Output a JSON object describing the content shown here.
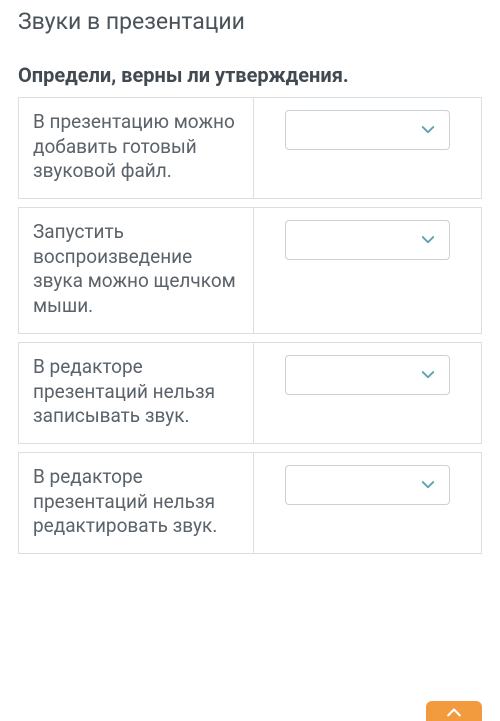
{
  "title": "Звуки в презентации",
  "instruction": "Определи, верны ли утверждения.",
  "rows": [
    {
      "text": "В презентацию можно добавить готовый звуковой файл.",
      "selected": ""
    },
    {
      "text": "Запустить воспроизведение звука можно щелчком мыши.",
      "selected": ""
    },
    {
      "text": "В редакторе презентаций нельзя записывать звук.",
      "selected": ""
    },
    {
      "text": "В редакторе презентаций нельзя редактировать звук.",
      "selected": ""
    }
  ],
  "colors": {
    "accent": "#5aa0b0",
    "fab": "#f19a3e",
    "border": "#dadfe3"
  }
}
